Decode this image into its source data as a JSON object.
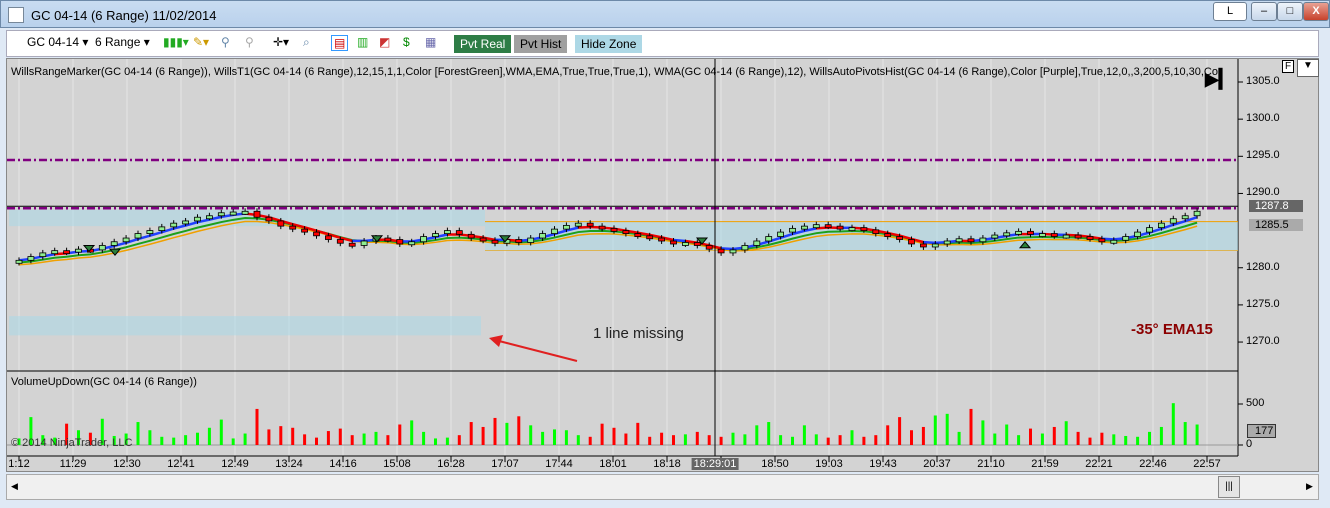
{
  "window": {
    "title": "GC 04-14 (6 Range)  11/02/2014",
    "link_button": "L",
    "minimize": "–",
    "maximize": "□",
    "close": "X"
  },
  "toolbar": {
    "instrument": "GC 04-14",
    "period": "6 Range",
    "pvt_real": "Pvt Real",
    "pvt_hist": "Pvt Hist",
    "hide_zone": "Hide Zone",
    "icons": [
      "candlestick-icon",
      "pencil-icon",
      "zoom-in-icon",
      "zoom-out-icon",
      "crosshair-icon",
      "search-icon",
      "chart-trader-icon",
      "bars-icon",
      "indicator-icon",
      "dollar-icon",
      "properties-icon"
    ]
  },
  "price_panel": {
    "indicator_label": "WillsRangeMarker(GC 04-14 (6 Range)), WillsT1(GC 04-14 (6 Range),12,15,1,1,Color [ForestGreen],WMA,EMA,True,True,True,1), WMA(GC 04-14 (6 Range),12), WillsAutoPivotsHist(GC 04-14 (6 Range),Color [Purple],True,12,0,,3,200,5,10,30,Co",
    "f_button": "F",
    "annotation": "1 line missing",
    "angle_label": "-35° EMA15",
    "last_price": "1287.8",
    "marker_price": "1285.5",
    "axis_ticks": [
      "1305.0",
      "1300.0",
      "1295.0",
      "1290.0",
      "1280.0",
      "1275.0",
      "1270.0"
    ],
    "colors": {
      "up": "#00ff00",
      "down": "#ff0000",
      "pivot": "#800080",
      "zone": "#add8e6",
      "ema_label": "#8b0000",
      "arrow": "#e02020"
    }
  },
  "volume_panel": {
    "label": "VolumeUpDown(GC 04-14 (6 Range))",
    "copyright": "© 2014 NinjaTrader, LLC",
    "axis_ticks": [
      "500",
      "0"
    ],
    "last_volume": "177"
  },
  "time_axis": {
    "labels": [
      "1:12",
      "11:29",
      "12:30",
      "12:41",
      "12:49",
      "13:24",
      "14:16",
      "15:08",
      "16:28",
      "17:07",
      "17:44",
      "18:01",
      "18:18",
      "18:29:01",
      "18:50",
      "19:03",
      "19:43",
      "20:37",
      "21:10",
      "21:59",
      "22:21",
      "22:46",
      "22:57"
    ],
    "crosshair_label": "18:29:01"
  },
  "chart_data": {
    "type": "candlestick",
    "ylim": [
      1267,
      1307
    ],
    "closes": [
      1281.0,
      1281.5,
      1282.0,
      1282.3,
      1282.1,
      1282.5,
      1282.4,
      1283.0,
      1283.5,
      1284.0,
      1284.6,
      1285.0,
      1285.5,
      1286.0,
      1286.3,
      1286.8,
      1287.0,
      1287.4,
      1287.5,
      1287.6,
      1286.8,
      1286.3,
      1285.6,
      1285.2,
      1284.8,
      1284.3,
      1283.8,
      1283.3,
      1283.0,
      1283.6,
      1284.0,
      1283.8,
      1283.2,
      1283.5,
      1284.2,
      1284.6,
      1285.0,
      1284.5,
      1284.0,
      1283.7,
      1283.3,
      1283.8,
      1283.4,
      1284.0,
      1284.6,
      1285.2,
      1285.7,
      1286.0,
      1285.6,
      1285.3,
      1285.0,
      1284.6,
      1284.3,
      1284.0,
      1283.6,
      1283.2,
      1283.4,
      1283.0,
      1282.5,
      1282.0,
      1282.4,
      1283.0,
      1283.6,
      1284.2,
      1284.8,
      1285.3,
      1285.6,
      1285.8,
      1285.6,
      1285.3,
      1285.4,
      1285.1,
      1284.6,
      1284.2,
      1283.8,
      1283.2,
      1282.8,
      1283.2,
      1283.6,
      1283.9,
      1283.5,
      1284.0,
      1284.4,
      1284.7,
      1284.9,
      1284.5,
      1284.6,
      1284.3,
      1284.4,
      1284.2,
      1283.9,
      1283.5,
      1283.7,
      1284.2,
      1284.8,
      1285.4,
      1286.0,
      1286.6,
      1287.0,
      1287.6
    ],
    "volumes": [
      80,
      340,
      120,
      90,
      260,
      180,
      150,
      320,
      110,
      140,
      280,
      180,
      100,
      90,
      120,
      150,
      210,
      310,
      80,
      140,
      440,
      190,
      230,
      210,
      130,
      90,
      170,
      200,
      120,
      140,
      160,
      120,
      250,
      300,
      160,
      80,
      90,
      120,
      280,
      220,
      330,
      270,
      350,
      240,
      160,
      190,
      180,
      120,
      100,
      260,
      210,
      140,
      270,
      100,
      150,
      120,
      130,
      160,
      120,
      100,
      150,
      130,
      240,
      280,
      120,
      100,
      240,
      130,
      90,
      120,
      180,
      100,
      120,
      240,
      340,
      180,
      220,
      360,
      380,
      160,
      440,
      300,
      140,
      250,
      120,
      200,
      140,
      220,
      290,
      160,
      90,
      150,
      130,
      110,
      100,
      160,
      220,
      510,
      280,
      250,
      180,
      170
    ]
  }
}
